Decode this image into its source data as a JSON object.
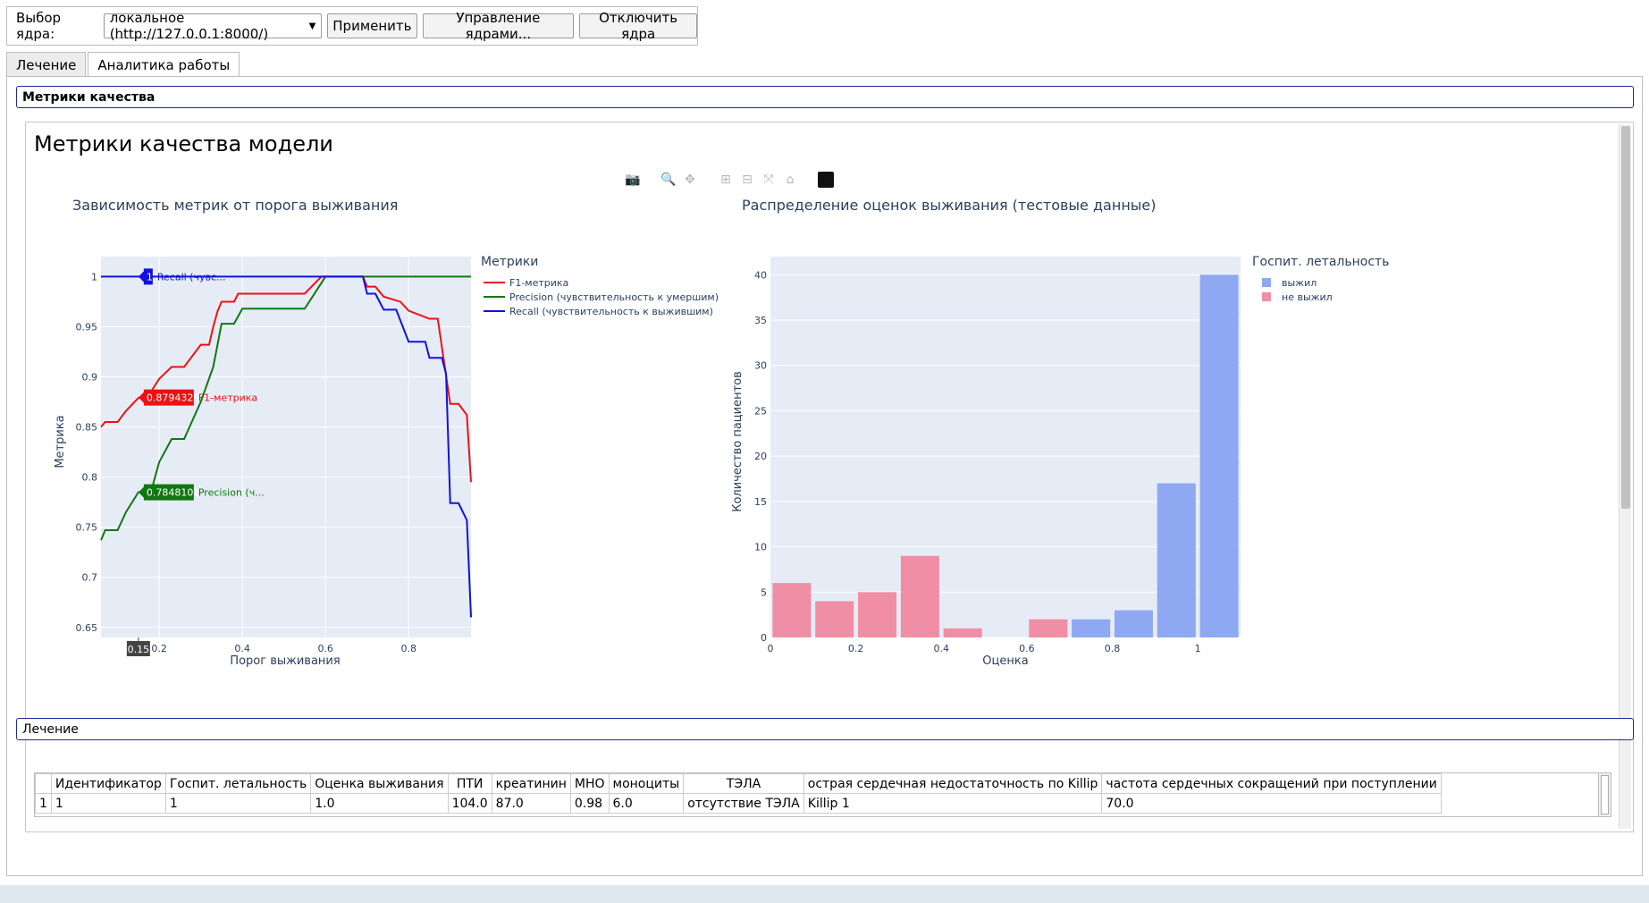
{
  "kernel": {
    "label": "Выбор ядра:",
    "selected": "локальное (http://127.0.0.1:8000/)",
    "apply_button": "Применить",
    "manage_button": "Управление ядрами...",
    "disconnect_button": "Отключить ядра"
  },
  "tabs": [
    {
      "label": "Лечение",
      "active": false
    },
    {
      "label": "Аналитика работы",
      "active": true
    }
  ],
  "accordion": {
    "metrics_header": "Метрики качества",
    "treatment_header": "Лечение"
  },
  "page_title": "Метрики качества модели",
  "modebar": [
    "camera-icon",
    "zoom-icon",
    "pan-icon",
    "zoom-in-icon",
    "zoom-out-icon",
    "autoscale-icon",
    "home-icon",
    "plotly-logo-icon"
  ],
  "chart_data": [
    {
      "type": "line",
      "title": "Зависимость метрик от порога выживания",
      "xlabel": "Порог выживания",
      "ylabel": "Метрика",
      "xlim": [
        0.06,
        0.95
      ],
      "ylim": [
        0.64,
        1.02
      ],
      "x_ticks": [
        0.2,
        0.4,
        0.6,
        0.8
      ],
      "x_tick_labels": [
        "0.2",
        "0.4",
        "0.6",
        "0.8"
      ],
      "y_ticks": [
        0.65,
        0.7,
        0.75,
        0.8,
        0.85,
        0.9,
        0.95,
        1
      ],
      "y_tick_labels": [
        "0.65",
        "0.7",
        "0.75",
        "0.8",
        "0.85",
        "0.9",
        "0.95",
        "1"
      ],
      "legend_title": "Метрики",
      "legend_position": "top-right",
      "grid": true,
      "colors": {
        "f1": "#ee1111",
        "precision": "#117711",
        "recall": "#1111dd",
        "plot_bg": "#e5ecf6"
      },
      "series": [
        {
          "name": "F1-метрика",
          "color": "#ee1111",
          "x": [
            0.06,
            0.07,
            0.1,
            0.12,
            0.15,
            0.18,
            0.2,
            0.23,
            0.26,
            0.3,
            0.32,
            0.33,
            0.34,
            0.35,
            0.38,
            0.39,
            0.4,
            0.55,
            0.59,
            0.6,
            0.69,
            0.7,
            0.72,
            0.74,
            0.78,
            0.8,
            0.85,
            0.87,
            0.9,
            0.92,
            0.94,
            0.95
          ],
          "y": [
            0.85,
            0.855,
            0.855,
            0.866,
            0.879,
            0.885,
            0.898,
            0.91,
            0.91,
            0.932,
            0.932,
            0.95,
            0.965,
            0.975,
            0.975,
            0.983,
            0.983,
            0.983,
            1,
            1,
            1,
            0.99,
            0.99,
            0.98,
            0.975,
            0.966,
            0.958,
            0.958,
            0.873,
            0.873,
            0.862,
            0.795
          ]
        },
        {
          "name": "Precision (чувствительность к умершим)",
          "color": "#117711",
          "x": [
            0.06,
            0.07,
            0.1,
            0.12,
            0.15,
            0.18,
            0.2,
            0.23,
            0.26,
            0.3,
            0.33,
            0.35,
            0.38,
            0.4,
            0.55,
            0.6,
            0.95
          ],
          "y": [
            0.737,
            0.747,
            0.747,
            0.765,
            0.785,
            0.785,
            0.815,
            0.838,
            0.838,
            0.875,
            0.91,
            0.953,
            0.953,
            0.968,
            0.968,
            1,
            1
          ]
        },
        {
          "name": "Recall (чувствительность к выжившим)",
          "color": "#1111dd",
          "x": [
            0.06,
            0.69,
            0.7,
            0.72,
            0.74,
            0.77,
            0.8,
            0.84,
            0.85,
            0.88,
            0.89,
            0.9,
            0.92,
            0.94,
            0.95
          ],
          "y": [
            1,
            1,
            0.983,
            0.983,
            0.967,
            0.967,
            0.935,
            0.935,
            0.919,
            0.919,
            0.903,
            0.774,
            0.774,
            0.757,
            0.66
          ]
        }
      ],
      "hover": {
        "x_label": "0.15",
        "recall_value": "1",
        "recall_name": "Recall (чувс...",
        "f1_value": "0.8794326",
        "f1_name": "F1-метрика",
        "precision_value": "0.7848101",
        "precision_name": "Precision (ч..."
      }
    },
    {
      "type": "bar",
      "title": "Распределение оценок выживания (тестовые данные)",
      "xlabel": "Оценка",
      "ylabel": "Количество пациентов",
      "xlim": [
        0,
        1.1
      ],
      "ylim": [
        0,
        42
      ],
      "x_ticks": [
        0,
        0.2,
        0.4,
        0.6,
        0.8,
        1
      ],
      "x_tick_labels": [
        "0",
        "0.2",
        "0.4",
        "0.6",
        "0.8",
        "1"
      ],
      "y_ticks": [
        0,
        5,
        10,
        15,
        20,
        25,
        30,
        35,
        40
      ],
      "y_tick_labels": [
        "0",
        "5",
        "10",
        "15",
        "20",
        "25",
        "30",
        "35",
        "40"
      ],
      "legend_title": "Госпит. летальность",
      "legend_position": "top-right",
      "grid": true,
      "bin_width": 0.1,
      "series": [
        {
          "name": "выжил",
          "color": "#8fa8f2",
          "bin_start": [
            0.7,
            0.8,
            0.9,
            1.0
          ],
          "values": [
            2,
            3,
            17,
            40
          ]
        },
        {
          "name": "не выжил",
          "color": "#f08ea5",
          "bin_start": [
            0.0,
            0.1,
            0.2,
            0.3,
            0.4,
            0.6
          ],
          "values": [
            6,
            4,
            5,
            9,
            1,
            2
          ]
        }
      ]
    }
  ],
  "table": {
    "columns": [
      "",
      "Идентификатор",
      "Госпит. летальность",
      "Оценка выживания",
      "ПТИ",
      "креатинин",
      "МНО",
      "моноциты",
      "ТЭЛА",
      "острая сердечная недостаточность по Killip",
      "частота сердечных сокращений при поступлении"
    ],
    "rows": [
      [
        "1",
        "1",
        "1",
        "1.0",
        "104.0",
        "87.0",
        "0.98",
        "6.0",
        "отсутствие ТЭЛА",
        "Killip 1",
        "70.0"
      ]
    ]
  }
}
